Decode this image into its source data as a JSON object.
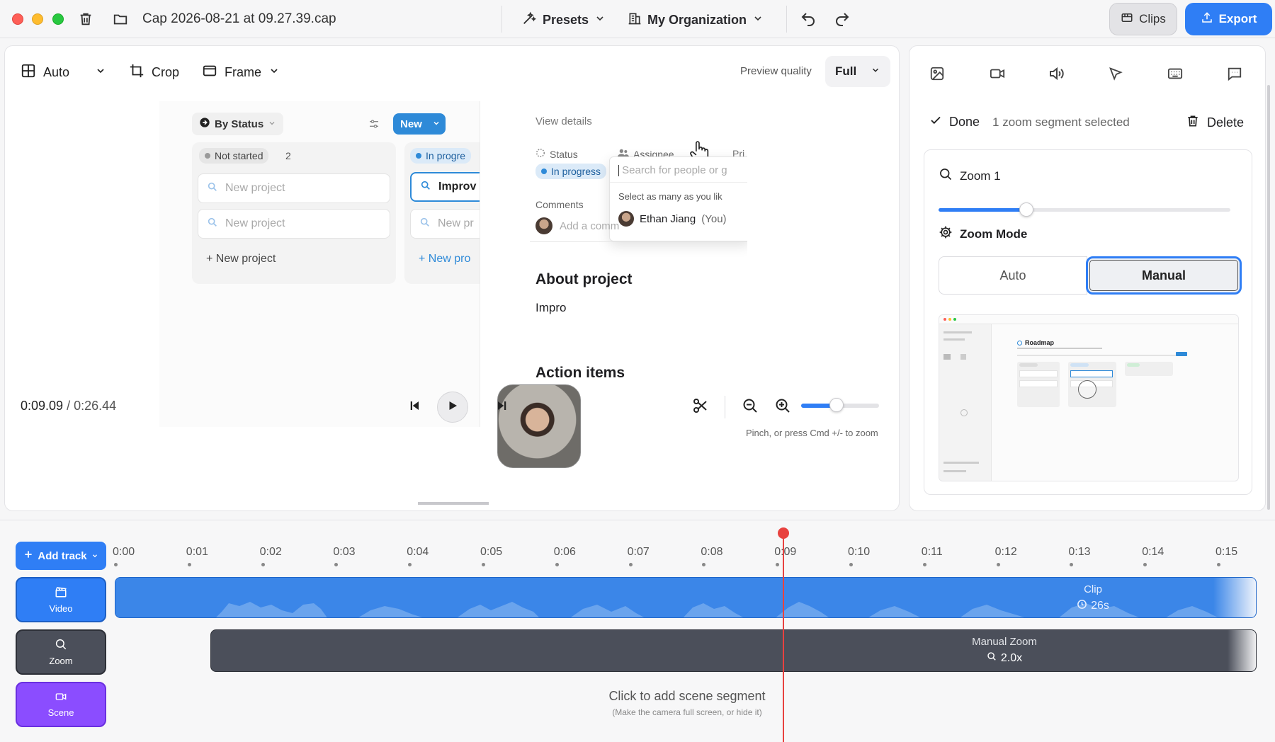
{
  "window": {
    "title": "Cap 2026-08-21 at 09.27.39.cap",
    "presets_label": "Presets",
    "org_label": "My Organization",
    "clips_label": "Clips",
    "export_label": "Export"
  },
  "editor_toolbar": {
    "layout_label": "Auto",
    "crop_label": "Crop",
    "frame_label": "Frame",
    "preview_quality_label": "Preview quality",
    "preview_quality_value": "Full"
  },
  "preview": {
    "group_by_label": "By Status",
    "new_label": "New",
    "columns": [
      {
        "status": "Not started",
        "count": "2",
        "cards": [
          "New project",
          "New project"
        ],
        "add_label": "+ New project"
      },
      {
        "status": "In progre",
        "cards": [
          "Improv",
          "New pr"
        ],
        "add_label": "+ New pro"
      }
    ],
    "view_details": "View details",
    "status_label": "Status",
    "status_value": "In progress",
    "assignee_label": "Assignee",
    "priority_stub": "Pri",
    "search_placeholder": "Search for people or g",
    "select_hint": "Select as many as you lik",
    "person_name": "Ethan Jiang",
    "person_you": "(You)",
    "comments_label": "Comments",
    "comment_placeholder": "Add a comm",
    "about_heading": "About project",
    "about_text": "Impro",
    "action_heading": "Action items"
  },
  "playback": {
    "current_time": "0:09.09",
    "total_time": "/ 0:26.44",
    "zoom_hint": "Pinch, or press Cmd +/- to zoom",
    "zoom_level": 0.45
  },
  "right_panel": {
    "done_label": "Done",
    "selected_label": "1 zoom segment selected",
    "delete_label": "Delete",
    "zoom_title": "Zoom 1",
    "zoom_amount": 0.3,
    "zoom_mode_label": "Zoom Mode",
    "mode_auto": "Auto",
    "mode_manual": "Manual",
    "thumb_heading": "Roadmap"
  },
  "timeline": {
    "add_track_label": "Add track",
    "ticks": [
      "0:00",
      "0:01",
      "0:02",
      "0:03",
      "0:04",
      "0:05",
      "0:06",
      "0:07",
      "0:08",
      "0:09",
      "0:10",
      "0:11",
      "0:12",
      "0:13",
      "0:14",
      "0:15"
    ],
    "tracks": {
      "video_label": "Video",
      "zoom_label": "Zoom",
      "scene_label": "Scene"
    },
    "clip_label": "Clip",
    "clip_duration": "26s",
    "manual_zoom_label": "Manual Zoom",
    "manual_zoom_value": "2.0x",
    "scene_hint": "Click to add scene segment",
    "scene_sub": "(Make the camera full screen, or hide it)"
  },
  "colors": {
    "accent": "#2f7ef5",
    "zoom_track": "#4b4f5a",
    "scene_track": "#8b4dff",
    "playhead": "#e8423f"
  }
}
